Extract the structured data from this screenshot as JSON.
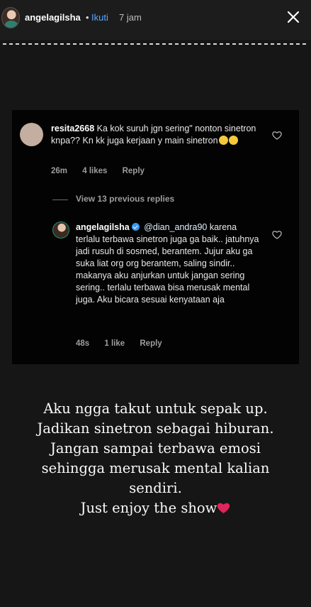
{
  "header": {
    "username": "angelagilsha",
    "separator": "•",
    "follow_label": "Ikuti",
    "time": "7 jam"
  },
  "comment": {
    "username": "resita2668",
    "text": "Ka kok suruh jgn sering\" nonton sinetron knpa?? Kn kk juga kerjaan y main sinetron",
    "time": "26m",
    "likes": "4 likes",
    "reply_label": "Reply"
  },
  "replies_toggle": "View 13 previous replies",
  "reply": {
    "username": "angelagilsha",
    "mention": "@dian_andra90",
    "text": "karena terlalu terbawa sinetron juga ga baik.. jatuhnya jadi rusuh di sosmed, berantem. Jujur aku ga suka liat org org berantem, saling sindir.. makanya aku anjurkan untuk jangan sering sering.. terlalu terbawa bisa merusak mental juga. Aku bicara sesuai kenyataan aja",
    "time": "48s",
    "likes": "1 like",
    "reply_label": "Reply"
  },
  "caption": {
    "lines": [
      "Aku ngga takut untuk sepak up.",
      "Jadikan sinetron sebagai hiburan.",
      "Jangan sampai terbawa emosi",
      "sehingga merusak mental kalian",
      "sendiri.",
      "Just enjoy the show"
    ]
  },
  "colors": {
    "follow": "#57a6ff",
    "verified": "#3897f0",
    "heart_emoji": "#e0245e"
  },
  "icons": [
    "close-icon",
    "heart-icon",
    "verified-icon",
    "laughing-emoji-icon",
    "red-heart-emoji-icon"
  ]
}
